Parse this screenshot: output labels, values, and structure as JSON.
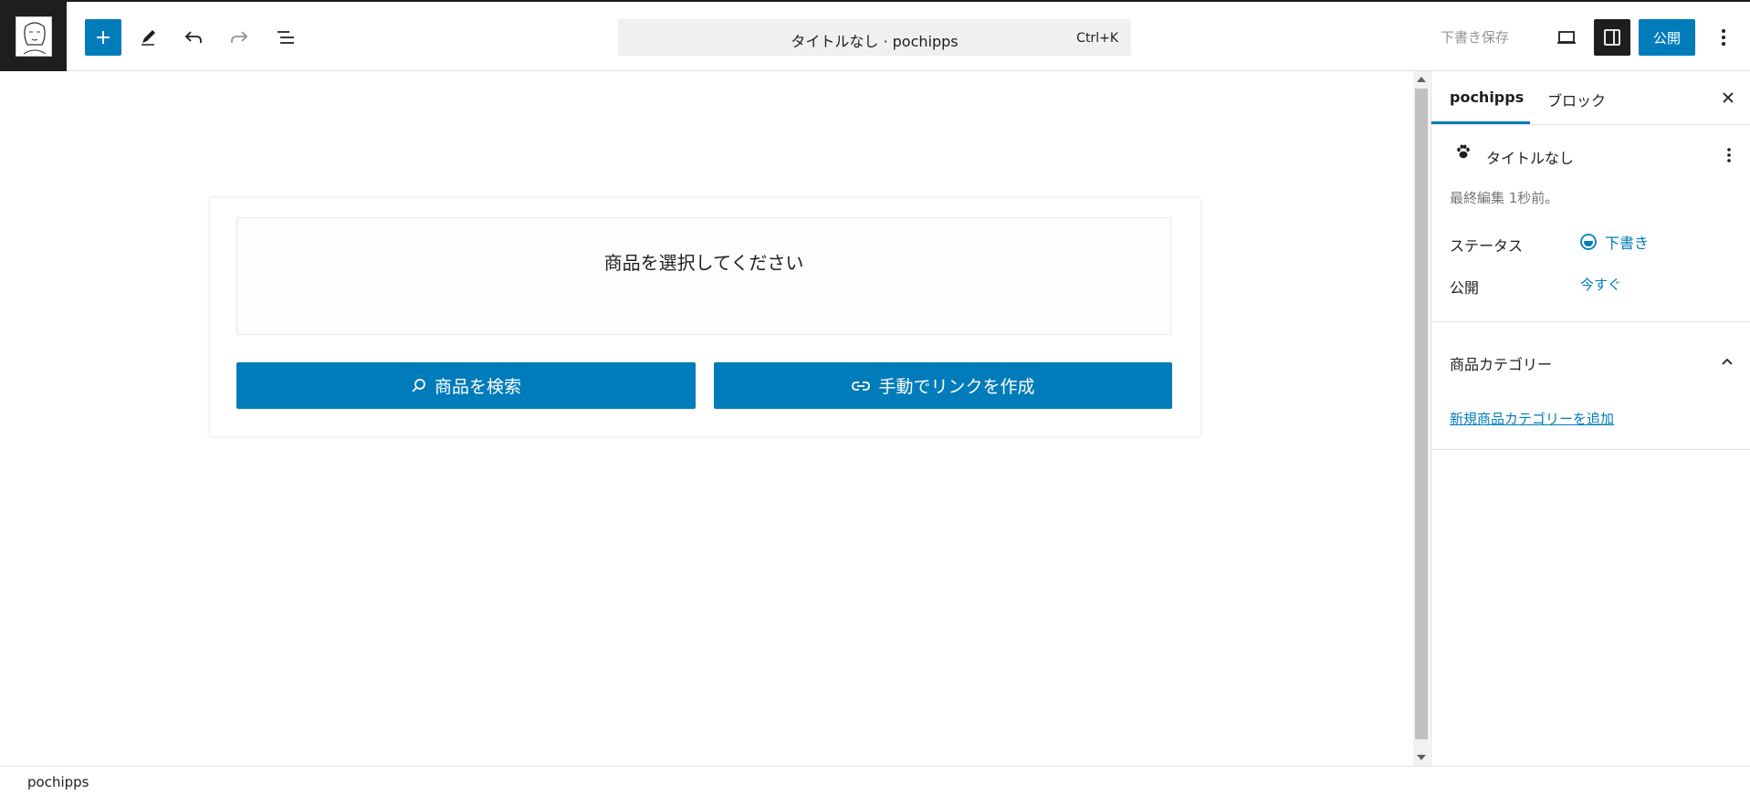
{
  "header": {
    "command_title": "タイトルなし · pochipps",
    "command_shortcut": "Ctrl+K",
    "save_draft_label": "下書き保存",
    "publish_label": "公開"
  },
  "canvas": {
    "placeholder_text": "商品を選択してください",
    "search_button_label": "商品を検索",
    "manual_link_button_label": "手動でリンクを作成"
  },
  "sidebar": {
    "tabs": [
      {
        "label": "pochipps",
        "active": true
      },
      {
        "label": "ブロック",
        "active": false
      }
    ],
    "document": {
      "title": "タイトルなし",
      "last_edited": "最終編集 1秒前。",
      "status_label": "ステータス",
      "status_value": "下書き",
      "publish_label": "公開",
      "publish_value": "今すぐ"
    },
    "category_panel": {
      "title": "商品カテゴリー",
      "add_link": "新規商品カテゴリーを追加"
    }
  },
  "footer": {
    "breadcrumb": "pochipps"
  },
  "colors": {
    "accent": "#007cba",
    "dark": "#1e1e1e",
    "muted": "#757575"
  }
}
